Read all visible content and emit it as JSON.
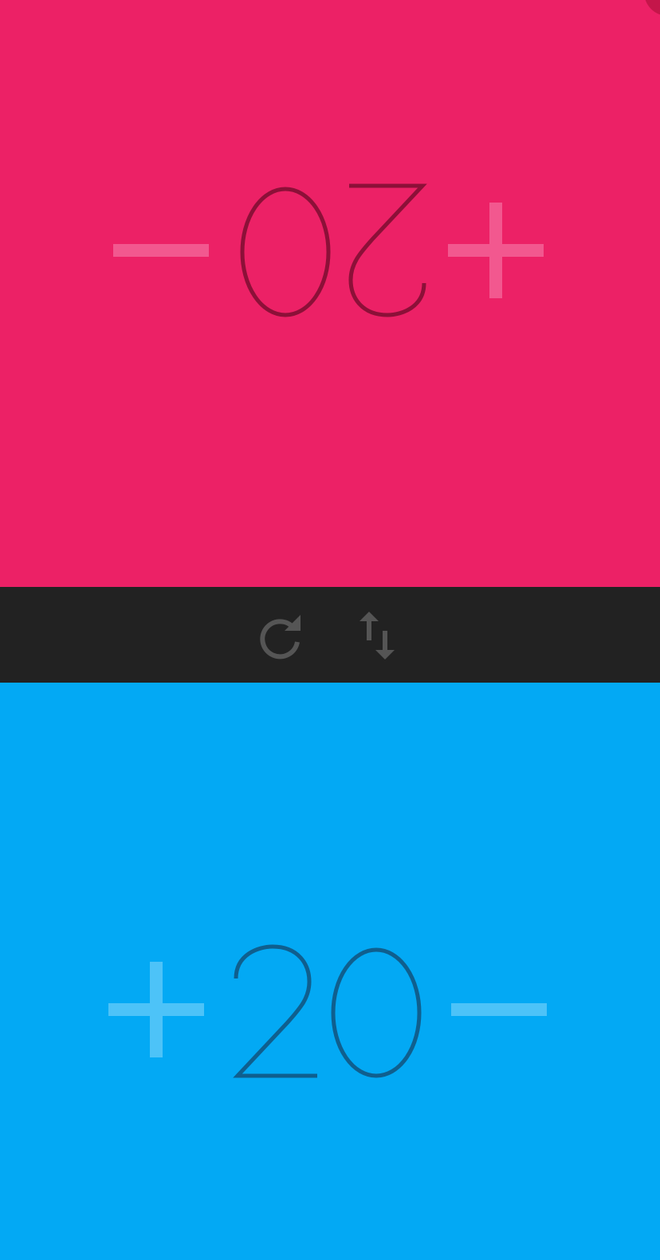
{
  "player_top": {
    "score": "20",
    "color": "#EC2166",
    "accent": "#F2588F",
    "digit_color": "#8C1038",
    "increment_label": "+",
    "decrement_label": "−",
    "rotated": true
  },
  "player_bottom": {
    "score": "20",
    "color": "#03A9F4",
    "accent": "#4DC3F8",
    "digit_color": "#0F5F8E",
    "increment_label": "+",
    "decrement_label": "−",
    "rotated": false
  },
  "toolbar": {
    "background": "#222222",
    "icon_color": "#555555",
    "reset_icon": "refresh-icon",
    "swap_icon": "swap-vertical-icon"
  }
}
